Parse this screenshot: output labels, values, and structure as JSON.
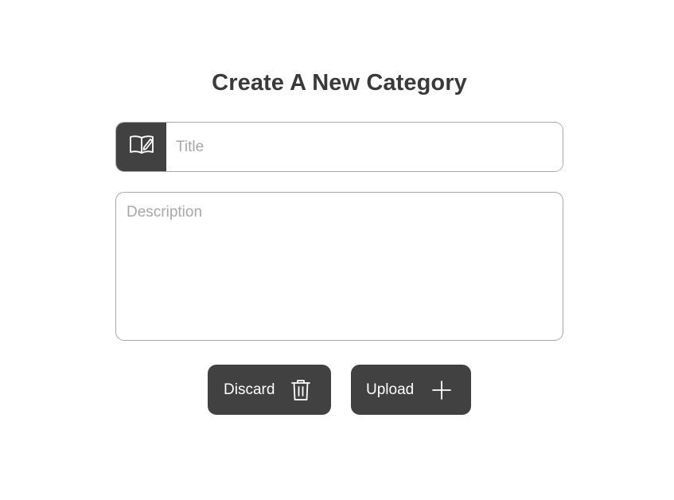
{
  "form": {
    "heading": "Create A New Category",
    "title_input": {
      "placeholder": "Title",
      "value": "",
      "icon": "book-edit-icon"
    },
    "description_input": {
      "placeholder": "Description",
      "value": ""
    },
    "buttons": {
      "discard": {
        "label": "Discard",
        "icon": "trash-icon"
      },
      "upload": {
        "label": "Upload",
        "icon": "plus-icon"
      }
    }
  },
  "colors": {
    "accent": "#414141",
    "heading": "#3a3a3a",
    "border": "#a9a9a9",
    "placeholder": "#a8a8a8",
    "background": "#ffffff"
  }
}
